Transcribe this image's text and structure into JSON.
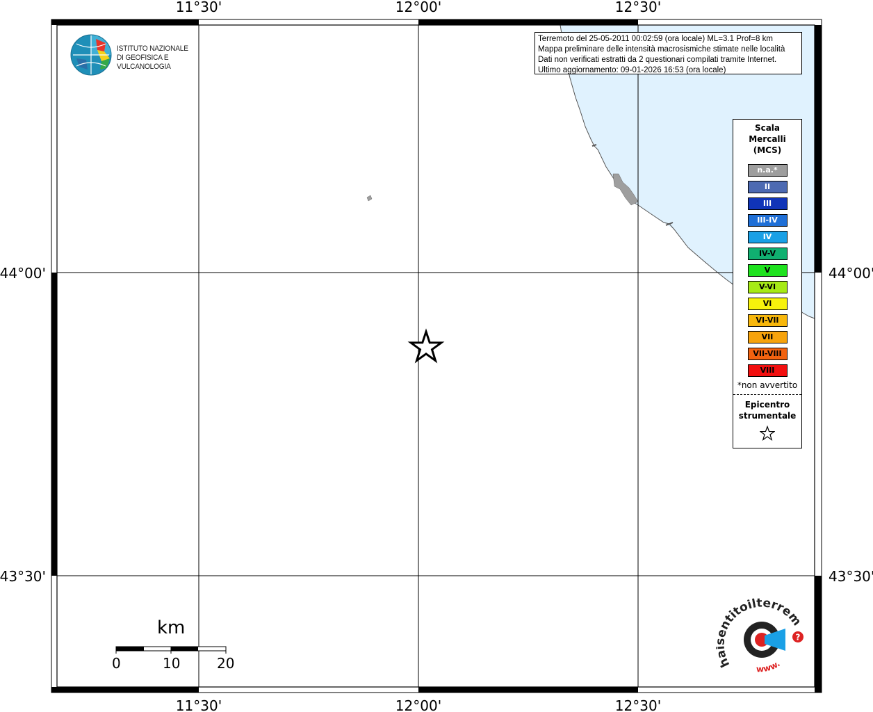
{
  "map": {
    "lon_ticks": [
      "11°30'",
      "12°00'",
      "12°30'"
    ],
    "lat_ticks": [
      "44°00'",
      "43°30'"
    ],
    "land_color": "#ffffff",
    "sea_color": "#e0f2fe",
    "grid_color": "#000000",
    "epicenter_symbol": "star-icon"
  },
  "info": {
    "line1": "Terremoto del 25-05-2011 00:02:59 (ora locale) ML=3.1 Prof=8 km",
    "line2": "Mappa preliminare delle intensità macrosismiche stimate nelle località",
    "line3": "Dati non verificati estratti da 2 questionari compilati tramite Internet.",
    "line4": "Ultimo aggiornamento: 09-01-2026 16:53 (ora locale)"
  },
  "logo": {
    "line1": "ISTITUTO NAZIONALE",
    "line2": "DI GEOFISICA E VULCANOLOGIA"
  },
  "legend": {
    "title1": "Scala",
    "title2": "Mercalli",
    "title3": "(MCS)",
    "items": [
      {
        "label": "n.a.*",
        "color": "#9e9e9e"
      },
      {
        "label": "II",
        "color": "#4d6ab2"
      },
      {
        "label": "III",
        "color": "#1034b8"
      },
      {
        "label": "III-IV",
        "color": "#1f6fd6"
      },
      {
        "label": "IV",
        "color": "#1aa0e6"
      },
      {
        "label": "IV-V",
        "color": "#10b070"
      },
      {
        "label": "V",
        "color": "#1fe21f"
      },
      {
        "label": "V-VI",
        "color": "#a6ea16"
      },
      {
        "label": "VI",
        "color": "#f7f20c"
      },
      {
        "label": "VI-VII",
        "color": "#f7b70c"
      },
      {
        "label": "VII",
        "color": "#f7a30c"
      },
      {
        "label": "VII-VIII",
        "color": "#f2620f"
      },
      {
        "label": "VIII",
        "color": "#f20f0f"
      }
    ],
    "note": "*non avvertito",
    "epi1": "Epicentro",
    "epi2": "strumentale",
    "epi_icon": "star-icon"
  },
  "scalebar": {
    "unit": "km",
    "labels": [
      "0",
      "10",
      "20"
    ]
  },
  "watermark": {
    "text": "haisentitoilterremoto.it",
    "url": "www.",
    "symbol": "?"
  }
}
